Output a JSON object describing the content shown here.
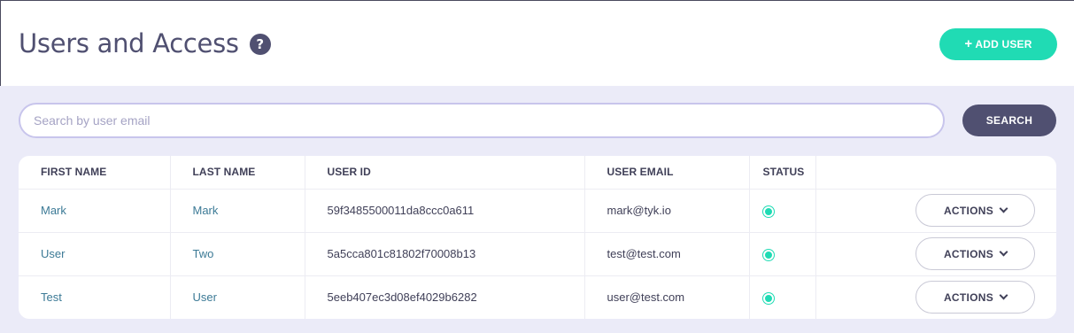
{
  "header": {
    "title": "Users and Access",
    "help_icon_glyph": "?",
    "add_user_label": "ADD USER",
    "add_user_icon": "+"
  },
  "search": {
    "placeholder": "Search by user email",
    "value": "",
    "button_label": "SEARCH"
  },
  "table": {
    "columns": [
      "FIRST NAME",
      "LAST NAME",
      "USER ID",
      "USER EMAIL",
      "STATUS",
      ""
    ],
    "rows": [
      {
        "first_name": "Mark",
        "last_name": "Mark",
        "user_id": "59f3485500011da8ccc0a611",
        "email": "mark@tyk.io",
        "status": "active",
        "actions_label": "ACTIONS"
      },
      {
        "first_name": "User",
        "last_name": "Two",
        "user_id": "5a5cca801c81802f70008b13",
        "email": "test@test.com",
        "status": "active",
        "actions_label": "ACTIONS"
      },
      {
        "first_name": "Test",
        "last_name": "User",
        "user_id": "5eeb407ec3d08ef4029b6282",
        "email": "user@test.com",
        "status": "active",
        "actions_label": "ACTIONS"
      }
    ]
  },
  "colors": {
    "accent": "#20dbb4",
    "primary_dark": "#505071",
    "link": "#3c7a96",
    "background": "#ebebf8"
  },
  "icons": {
    "help": "question-circle-icon",
    "add": "plus-icon",
    "actions": "chevron-down-icon",
    "status": "status-dot-icon"
  }
}
